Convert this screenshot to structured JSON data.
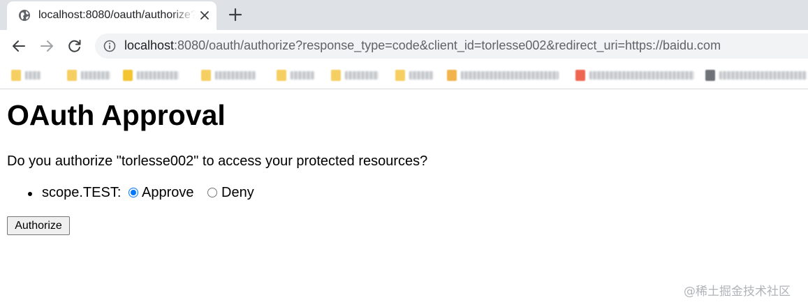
{
  "browser": {
    "tab": {
      "title": "localhost:8080/oauth/authorize?response_type=code&client_id=torlesse002",
      "favicon": "globe-icon",
      "close_icon": "close-icon"
    },
    "new_tab_icon": "plus-icon",
    "nav": {
      "back_icon": "back-arrow-icon",
      "forward_icon": "forward-arrow-icon",
      "reload_icon": "reload-icon"
    },
    "address_bar": {
      "info_icon": "info-icon",
      "url_host": "localhost",
      "url_rest": ":8080/oauth/authorize?response_type=code&client_id=torlesse002&redirect_uri=https://baidu.com"
    },
    "bookmarks_bar": {
      "note": ""
    }
  },
  "page": {
    "heading": "OAuth Approval",
    "question": "Do you authorize \"torlesse002\" to access your protected resources?",
    "scopes": [
      {
        "label": "scope.TEST:",
        "options": [
          "Approve",
          "Deny"
        ],
        "selected": "Approve"
      }
    ],
    "submit_label": "Authorize"
  },
  "watermark": "@稀土掘金技术社区",
  "colors": {
    "tabstrip": "#dee1e6",
    "radio_checked": "#0075ff",
    "omnibox": "#f1f3f4"
  }
}
